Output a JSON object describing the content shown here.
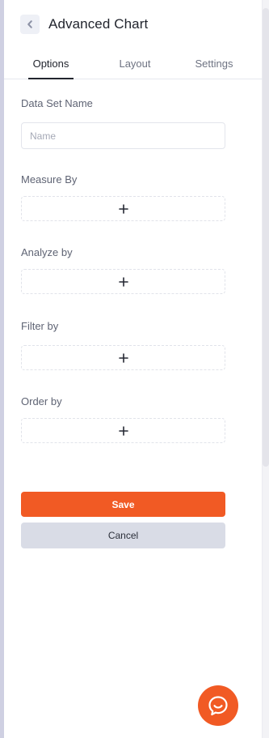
{
  "header": {
    "title": "Advanced Chart",
    "back_icon": "chevron-left-icon"
  },
  "tabs": [
    {
      "label": "Options",
      "active": true
    },
    {
      "label": "Layout",
      "active": false
    },
    {
      "label": "Settings",
      "active": false
    }
  ],
  "form": {
    "data_set_name": {
      "label": "Data Set Name",
      "placeholder": "Name",
      "value": ""
    },
    "measure_by": {
      "label": "Measure By",
      "add_icon": "plus-icon"
    },
    "analyze_by": {
      "label": "Analyze by",
      "add_icon": "plus-icon"
    },
    "filter_by": {
      "label": "Filter by",
      "add_icon": "plus-icon"
    },
    "order_by": {
      "label": "Order by",
      "add_icon": "plus-icon"
    }
  },
  "actions": {
    "save_label": "Save",
    "cancel_label": "Cancel"
  },
  "chat": {
    "icon": "chat-bubble-icon"
  },
  "colors": {
    "accent": "#f15a24",
    "secondary_button": "#d9dce6",
    "text_primary": "#22252e",
    "text_muted": "#5f6474",
    "border": "#e3e5ec"
  }
}
